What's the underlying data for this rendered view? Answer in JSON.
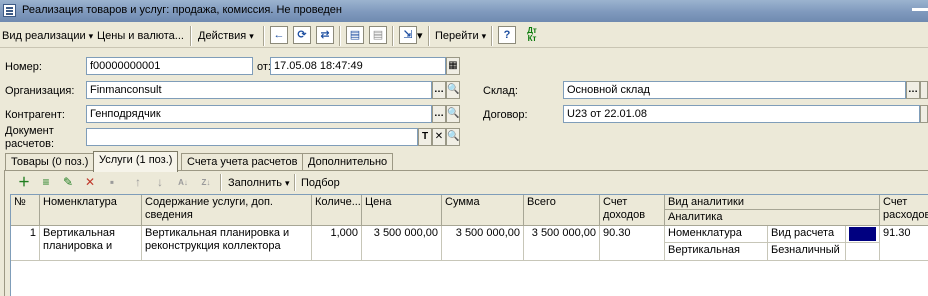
{
  "window": {
    "title": "Реализация товаров и услуг: продажа, комиссия. Не проведен"
  },
  "toolbar": {
    "view": "Вид реализации",
    "prices": "Цены и валюта...",
    "actions": "Действия",
    "goto": "Перейти",
    "help": "?",
    "dtkt": "Дт Кт"
  },
  "header": {
    "number_label": "Номер:",
    "number": "f00000000001",
    "date_label": "от:",
    "date": "17.05.08 18:47:49",
    "org_label": "Организация:",
    "org": "Finmanconsult",
    "warehouse_label": "Склад:",
    "warehouse": "Основной склад",
    "contractor_label": "Контрагент:",
    "contractor": "Генподрядчик",
    "contract_label": "Договор:",
    "contract": "U23  от 22.01.08",
    "settlement_doc_label_1": "Документ",
    "settlement_doc_label_2": "расчетов:",
    "settlement_doc": ""
  },
  "tabs": [
    {
      "label": "Товары (0 поз.)"
    },
    {
      "label": "Услуги (1 поз.)"
    },
    {
      "label": "Счета учета расчетов"
    },
    {
      "label": "Дополнительно"
    }
  ],
  "services_toolbar": {
    "fill": "Заполнить",
    "pick": "Подбор"
  },
  "table": {
    "headers": {
      "n": "№",
      "nomenclature": "Номенклатура",
      "content_1": "Содержание услуги, доп.",
      "content_2": "сведения",
      "qty": "Количе...",
      "price": "Цена",
      "sum": "Сумма",
      "total": "Всего",
      "acc_income_1": "Счет",
      "acc_income_2": "доходов",
      "analytics_kind": "Вид аналитики",
      "analytics": "Аналитика",
      "acc_expense_1": "Счет",
      "acc_expense_2": "расходов"
    },
    "row": {
      "n": "1",
      "nomenclature_1": "Вертикальная",
      "nomenclature_2": "планировка и",
      "content_1": "Вертикальная планировка и",
      "content_2": "реконструкция коллектора",
      "qty": "1,000",
      "price": "3 500 000,00",
      "sum": "3 500 000,00",
      "total": "3 500 000,00",
      "acc_income": "90.30",
      "analytic_1_name": "Номенклатура",
      "analytic_1_kind": "Вид расчета",
      "analytic_2_name": "Вертикальная пл...",
      "analytic_2_kind": "Безналичный",
      "acc_expense": "91.30",
      "marker_color": "#000080"
    }
  }
}
